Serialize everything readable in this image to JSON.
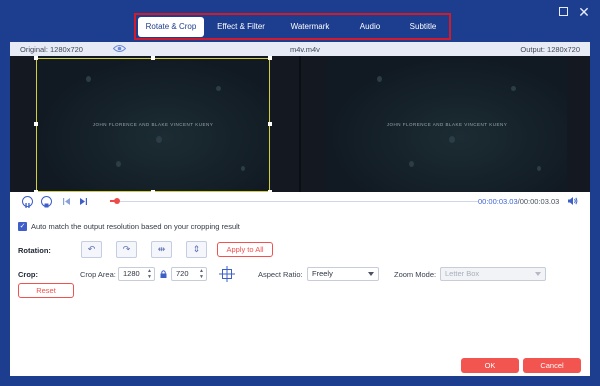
{
  "window": {
    "maximize_icon": "maximize-icon",
    "close_icon": "close-icon",
    "close_glyph": "✕"
  },
  "tabs": [
    {
      "label": "Rotate & Crop",
      "active": true
    },
    {
      "label": "Effect & Filter",
      "active": false
    },
    {
      "label": "Watermark",
      "active": false
    },
    {
      "label": "Audio",
      "active": false
    },
    {
      "label": "Subtitle",
      "active": false
    }
  ],
  "info_bar": {
    "original": "Original: 1280x720",
    "filename": "m4v.m4v",
    "output": "Output: 1280x720"
  },
  "preview": {
    "credit_text": "JOHN FLORENCE AND BLAKE VINCENT KUENY"
  },
  "playback": {
    "current_time": "00:00:03.03",
    "total_time": "/00:00:03.03",
    "progress": 0.02
  },
  "auto_match": {
    "checked": true,
    "label": "Auto match the output resolution based on your cropping result"
  },
  "rotation": {
    "label": "Rotation:",
    "buttons": [
      "rotate-left-icon",
      "rotate-right-icon",
      "flip-horizontal-icon",
      "flip-vertical-icon"
    ],
    "glyphs": [
      "↶",
      "↷",
      "⇹",
      "⇕"
    ],
    "apply_all": "Apply to All"
  },
  "crop": {
    "label": "Crop:",
    "area_label": "Crop Area:",
    "width": "1280",
    "height": "720",
    "aspect_label": "Aspect Ratio:",
    "aspect_value": "Freely",
    "zoom_label": "Zoom Mode:",
    "zoom_value": "Letter Box",
    "reset": "Reset"
  },
  "footer": {
    "ok": "OK",
    "cancel": "Cancel"
  },
  "colors": {
    "background": "#1d3d8f",
    "accent": "#3e5fc8",
    "danger": "#f2544f",
    "highlight_box": "#d11a2a"
  }
}
